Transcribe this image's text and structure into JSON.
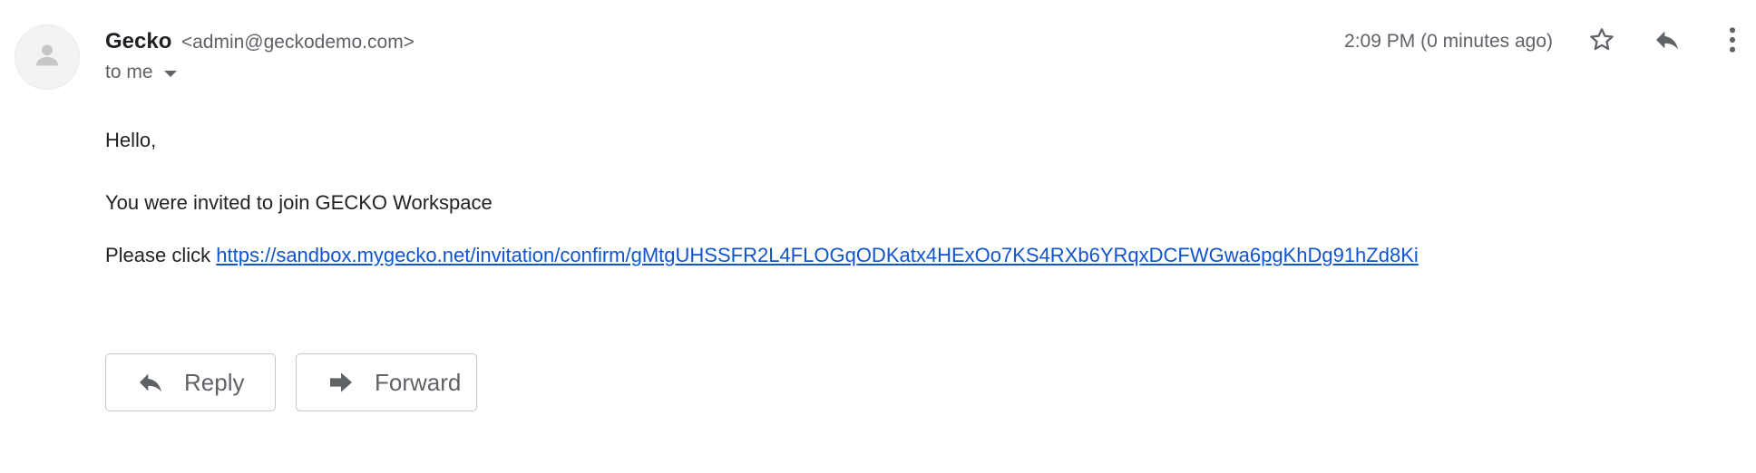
{
  "message": {
    "sender_name": "Gecko",
    "sender_email": "<admin@geckodemo.com>",
    "recipient_label": "to me",
    "timestamp": "2:09 PM (0 minutes ago)"
  },
  "body": {
    "greeting": "Hello,",
    "invite_text": "You were invited to join GECKO Workspace",
    "click_prefix": "Please click",
    "link_url": "https://sandbox.mygecko.net/invitation/confirm/gMtgUHSSFR2L4FLOGqODKatx4HExOo7KS4RXb6YRqxDCFWGwa6pgKhDg91hZd8Ki"
  },
  "actions": {
    "reply_label": "Reply",
    "forward_label": "Forward"
  },
  "icons": {
    "avatar": "person-icon",
    "star": "star-icon",
    "reply": "reply-icon",
    "more": "more-vert-icon",
    "forward": "forward-icon"
  },
  "colors": {
    "link": "#1155cc",
    "secondary_text": "#5f6368",
    "icon": "#5f6368"
  }
}
